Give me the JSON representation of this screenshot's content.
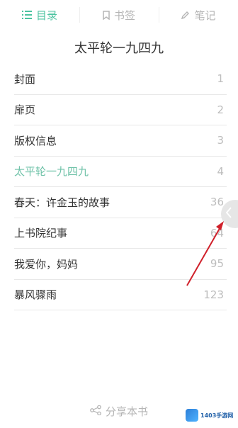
{
  "tabs": [
    {
      "label": "目录",
      "icon": "list-icon",
      "active": true
    },
    {
      "label": "书签",
      "icon": "bookmark-icon",
      "active": false
    },
    {
      "label": "笔记",
      "icon": "pencil-icon",
      "active": false
    }
  ],
  "book_title": "太平轮一九四九",
  "toc": [
    {
      "label": "封面",
      "page": "1"
    },
    {
      "label": "扉页",
      "page": "2"
    },
    {
      "label": "版权信息",
      "page": "3"
    },
    {
      "label": "太平轮一九四九",
      "page": "4",
      "current": true
    },
    {
      "label": "春天：许金玉的故事",
      "page": "36"
    },
    {
      "label": "上书院纪事",
      "page": "64"
    },
    {
      "label": "我爱你，妈妈",
      "page": "95"
    },
    {
      "label": "暴风骤雨",
      "page": "123"
    }
  ],
  "share_label": "分享本书",
  "watermark": {
    "line1": "1403手游网"
  },
  "colors": {
    "accent": "#4cc3a0",
    "current": "#6fc2a8",
    "arrow": "#d0202a"
  }
}
